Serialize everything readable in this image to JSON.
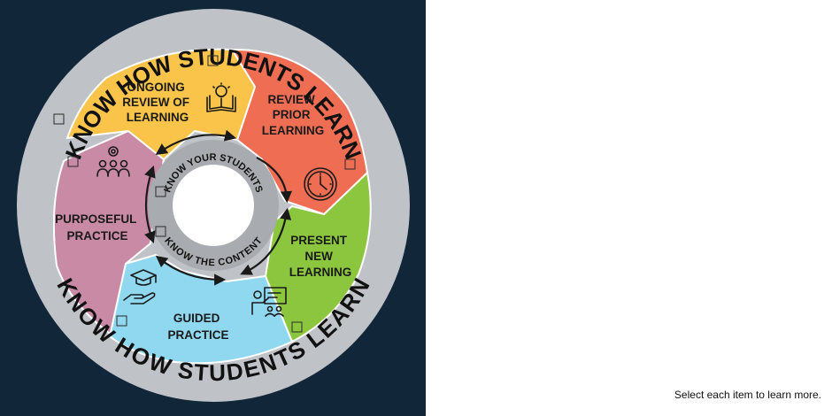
{
  "outer_ring": {
    "top_text": "KNOW HOW STUDENTS LEARN",
    "bottom_text": "KNOW HOW STUDENTS LEARN"
  },
  "inner_ring": {
    "top_text": "KNOW YOUR STUDENTS",
    "bottom_text": "KNOW THE CONTENT"
  },
  "segments": {
    "ongoing": {
      "lines": [
        "ONGOING",
        "REVIEW OF",
        "LEARNING"
      ],
      "color": "#f9c449",
      "icon": "open-book-lightbulb-icon"
    },
    "review": {
      "lines": [
        "REVIEW",
        "PRIOR",
        "LEARNING"
      ],
      "color": "#ef6e53",
      "icon": "clock-icon"
    },
    "present": {
      "lines": [
        "PRESENT",
        "NEW",
        "LEARNING"
      ],
      "color": "#8cc63f",
      "icon": "teacher-presenting-icon"
    },
    "guided": {
      "lines": [
        "GUIDED",
        "PRACTICE"
      ],
      "color": "#8fd8f0",
      "icon": "graduation-cap-hand-icon"
    },
    "purposeful": {
      "lines": [
        "PURPOSEFUL",
        "PRACTICE"
      ],
      "color": "#c98aa5",
      "icon": "group-gear-icon"
    }
  },
  "colors": {
    "background": "#12263a",
    "outer_ring": "#bfc2c6",
    "inner_ring": "#a8abb0"
  },
  "instruction": "Select each item to learn more."
}
